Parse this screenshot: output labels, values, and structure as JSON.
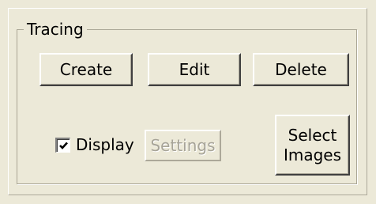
{
  "group": {
    "title": "Tracing"
  },
  "buttons": {
    "create": "Create",
    "edit": "Edit",
    "delete": "Delete",
    "settings": "Settings",
    "select_line1": "Select",
    "select_line2": "Images"
  },
  "display": {
    "label": "Display",
    "checked": true
  },
  "icons": {
    "checkbox": "checkmark-icon"
  },
  "colors": {
    "background": "#ece9d8",
    "disabled_text": "#a7a498"
  }
}
